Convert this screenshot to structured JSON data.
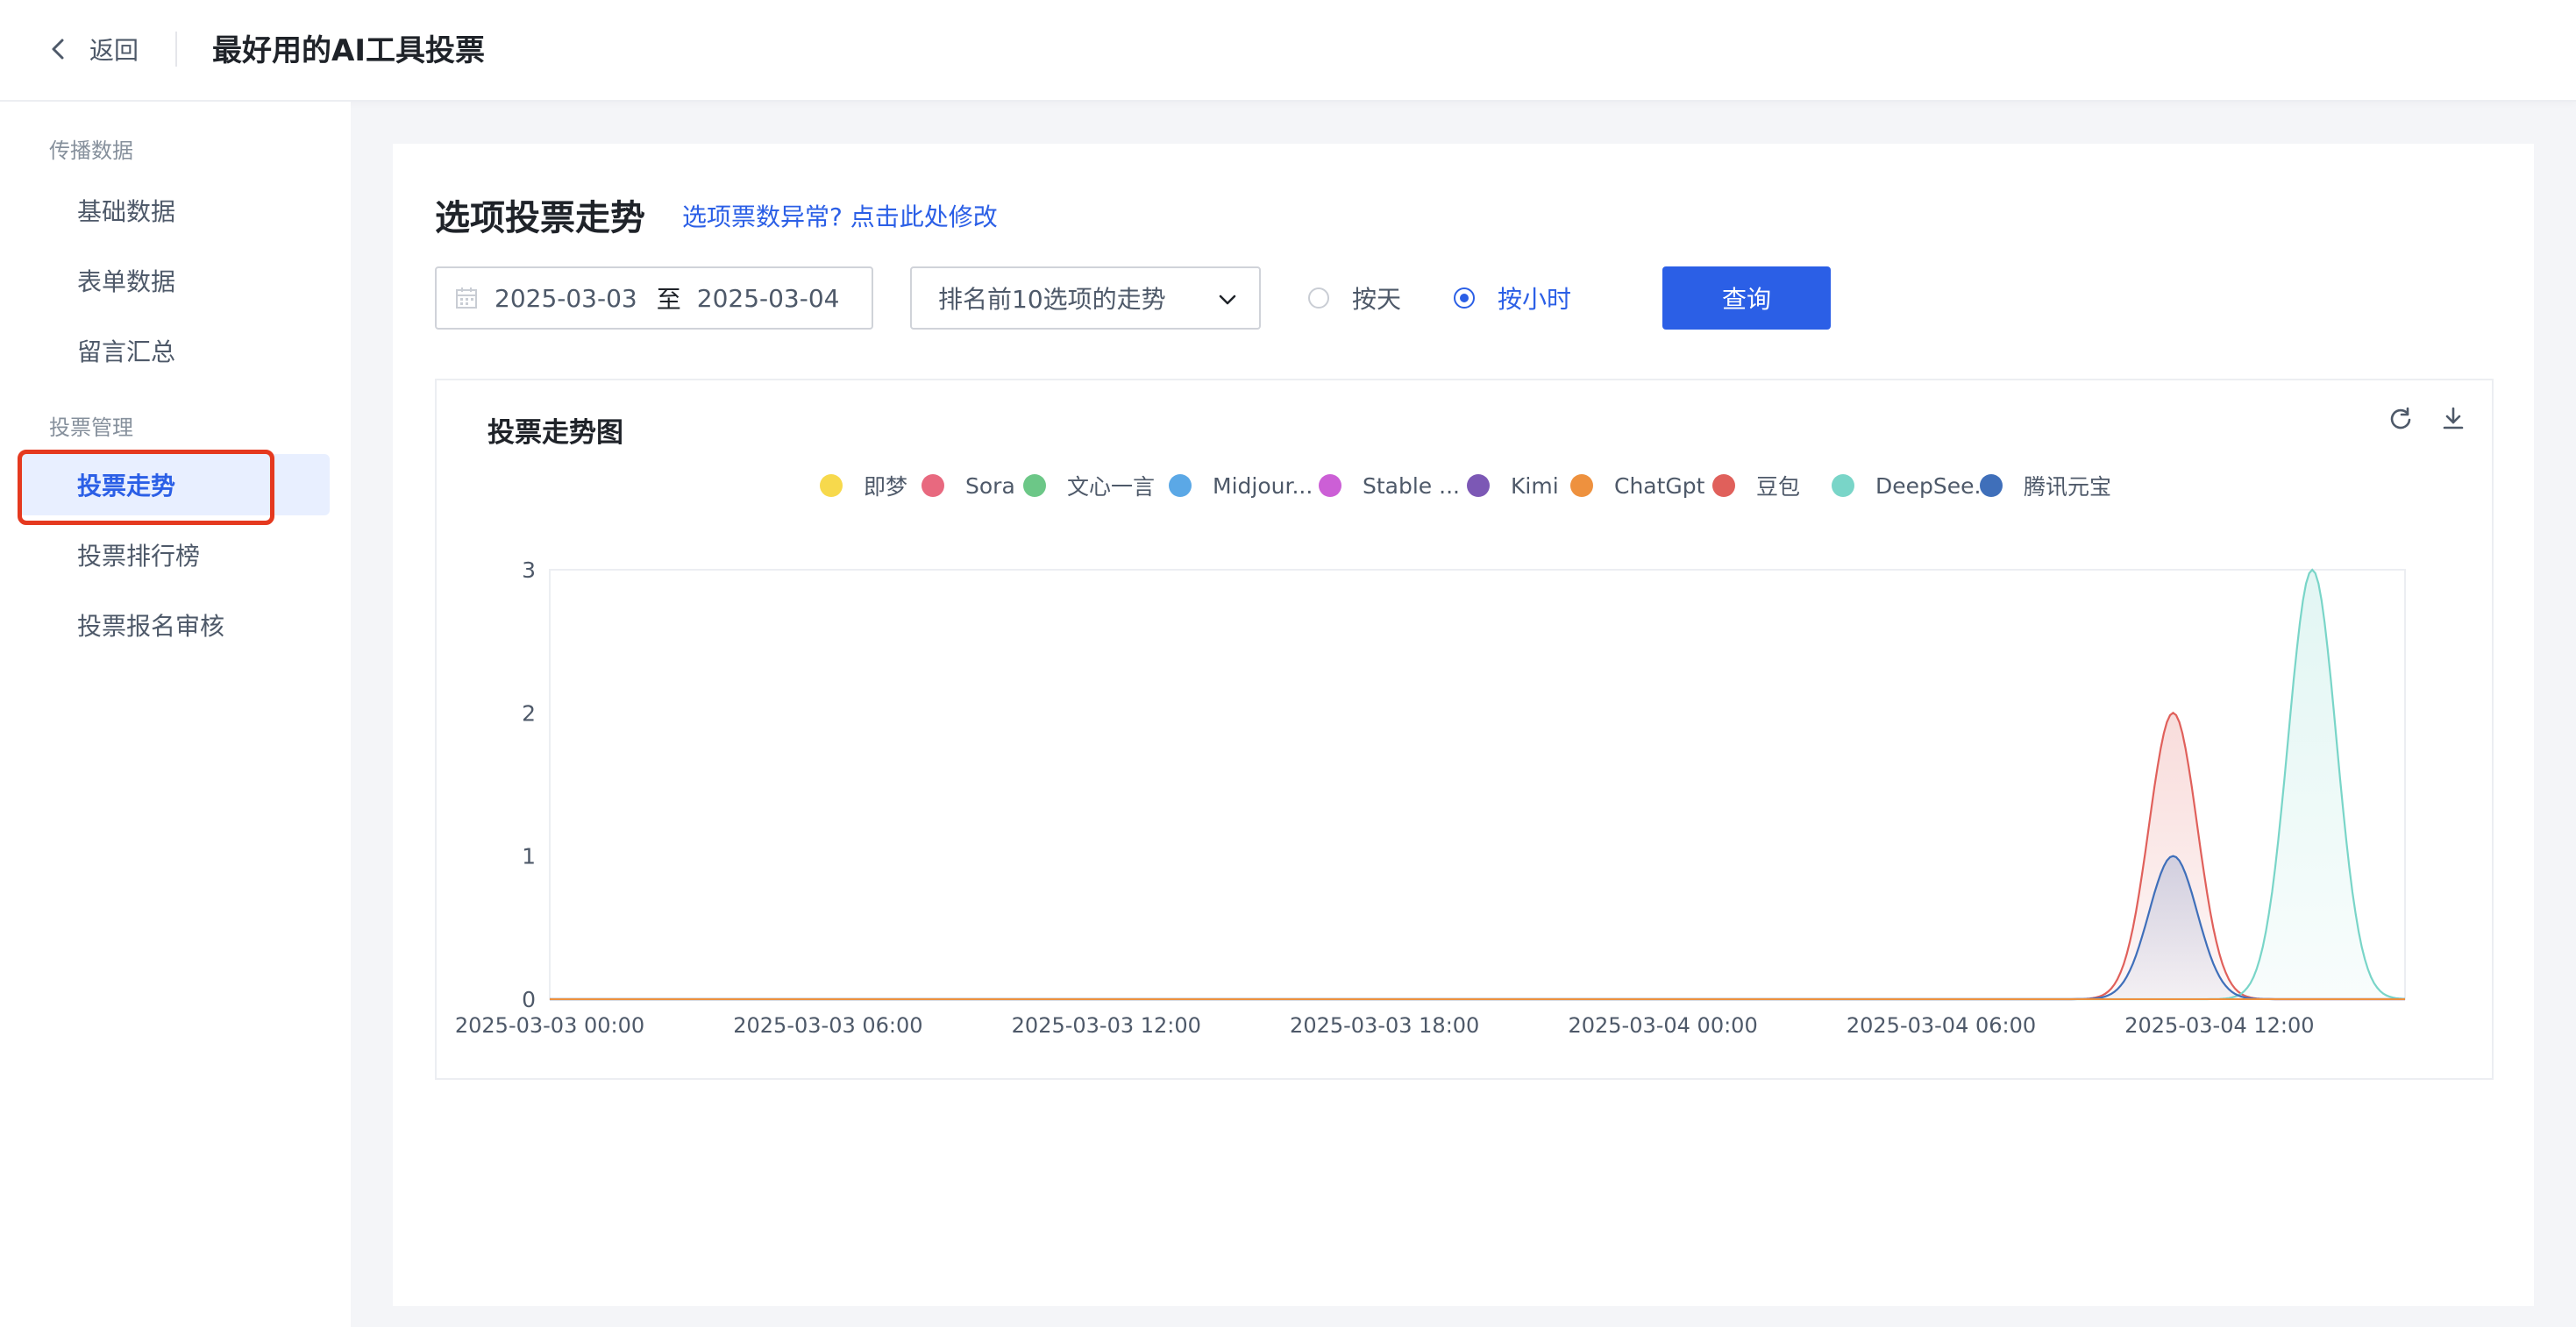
{
  "header": {
    "back_label": "返回",
    "title": "最好用的AI工具投票"
  },
  "sidebar": {
    "groups": [
      {
        "title": "传播数据",
        "items": [
          {
            "label": "基础数据"
          },
          {
            "label": "表单数据"
          },
          {
            "label": "留言汇总"
          }
        ]
      },
      {
        "title": "投票管理",
        "items": [
          {
            "label": "投票走势",
            "active": true
          },
          {
            "label": "投票排行榜"
          },
          {
            "label": "投票报名审核"
          }
        ]
      }
    ]
  },
  "main": {
    "section_title": "选项投票走势",
    "fix_link": "选项票数异常? 点击此处修改",
    "date_start": "2025-03-03",
    "date_sep": "至",
    "date_end": "2025-03-04",
    "select_value": "排名前10选项的走势",
    "radio_day": "按天",
    "radio_hour": "按小时",
    "radio_selected": "按小时",
    "query_label": "查询",
    "icons": {
      "refresh": "refresh-icon",
      "download": "download-icon",
      "calendar": "calendar-icon",
      "select": "chevron-down-icon",
      "back": "chevron-left-icon"
    },
    "accent_color": "#2b5fe6"
  },
  "chart_data": {
    "type": "area",
    "title": "投票走势图",
    "legend_position": "top",
    "x": [
      "2025-03-03 00:00",
      "2025-03-03 06:00",
      "2025-03-03 12:00",
      "2025-03-03 18:00",
      "2025-03-04 00:00",
      "2025-03-04 06:00",
      "2025-03-04 12:00"
    ],
    "x_range": [
      "2025-03-03 00:00",
      "2025-03-04 16:00"
    ],
    "ylim": [
      0,
      3
    ],
    "yticks": [
      0,
      1,
      2,
      3
    ],
    "grid": false,
    "series": [
      {
        "name": "即梦",
        "color": "#f7d94c",
        "points": []
      },
      {
        "name": "Sora",
        "color": "#e8697f",
        "points": []
      },
      {
        "name": "文心一言",
        "color": "#6cc787",
        "points": []
      },
      {
        "name": "Midjour...",
        "color": "#5ba8e6",
        "points": []
      },
      {
        "name": "Stable ...",
        "color": "#cc5fd6",
        "points": []
      },
      {
        "name": "Kimi",
        "color": "#7c58b5",
        "points": []
      },
      {
        "name": "ChatGpt",
        "color": "#ee913e",
        "points": []
      },
      {
        "name": "豆包",
        "color": "#e0605b",
        "points": [
          {
            "x": "2025-03-04 11:00",
            "y": 2
          }
        ]
      },
      {
        "name": "DeepSee...",
        "color": "#79d5c8",
        "points": [
          {
            "x": "2025-03-04 14:00",
            "y": 3
          }
        ]
      },
      {
        "name": "腾讯元宝",
        "color": "#3f6fba",
        "points": [
          {
            "x": "2025-03-04 11:00",
            "y": 1
          }
        ]
      }
    ]
  }
}
